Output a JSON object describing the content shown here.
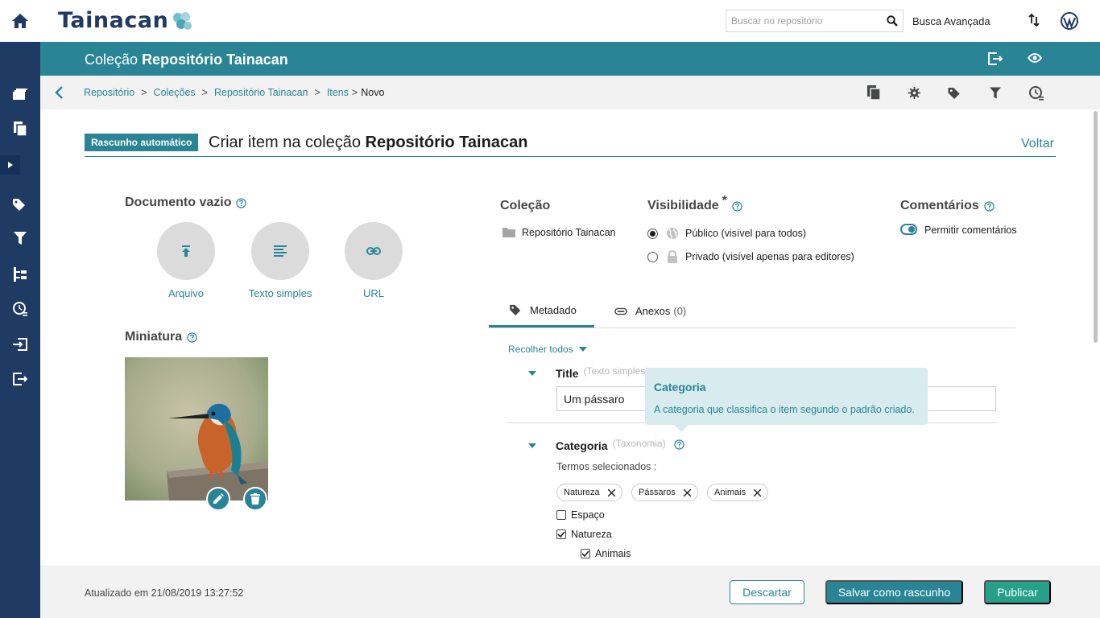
{
  "header": {
    "logo_text": "Tainacan",
    "search_placeholder": "Buscar no repositório",
    "advanced_search": "Busca Avançada"
  },
  "collection_bar": {
    "prefix": "Coleção",
    "name": "Repositório Tainacan"
  },
  "breadcrumb": {
    "items": [
      "Repositório",
      "Coleções",
      "Repositório Tainacan",
      "Itens"
    ],
    "current": "Novo",
    "separator": ">"
  },
  "page": {
    "draft_badge": "Rascunho automático",
    "title_prefix": "Criar item na coleção",
    "title_collection": "Repositório Tainacan",
    "back_link": "Voltar"
  },
  "document": {
    "title": "Documento vazio",
    "options": [
      "Arquivo",
      "Texto simples",
      "URL"
    ]
  },
  "thumbnail": {
    "title": "Miniatura"
  },
  "collection_info": {
    "title": "Coleção",
    "value": "Repositório Tainacan"
  },
  "visibility": {
    "title": "Visibilidade",
    "required_mark": "*",
    "options": [
      "Público (visível para todos)",
      "Privado (visível apenas para editores)"
    ],
    "selected": 0
  },
  "comments": {
    "title": "Comentários",
    "toggle_label": "Permitir comentários",
    "enabled": true
  },
  "tabs": {
    "metadata": "Metadado",
    "attachments": "Anexos",
    "attachments_count": "(0)"
  },
  "metadata": {
    "collapse_all": "Recolher todos",
    "title_field": {
      "name": "Title",
      "type": "(Texto simples)",
      "value": "Um pássaro"
    },
    "category_field": {
      "name": "Categoria",
      "type": "(Taxonomia)",
      "selected_label": "Termos selecionados :",
      "selected_terms": [
        "Natureza",
        "Pássaros",
        "Animais"
      ],
      "terms": [
        {
          "label": "Espaço",
          "checked": false
        },
        {
          "label": "Natureza",
          "checked": true
        },
        {
          "label": "Animais",
          "checked": true
        }
      ]
    }
  },
  "tooltip": {
    "title": "Categoria",
    "text": "A categoria que classifica o item segundo o padrão criado."
  },
  "footer": {
    "updated": "Atualizado em 21/08/2019 13:27:52",
    "discard": "Descartar",
    "save_draft": "Salvar como rascunho",
    "publish": "Publicar"
  },
  "colors": {
    "primary": "#298596",
    "sidebar": "#1f3a63",
    "publish": "#25a189"
  }
}
